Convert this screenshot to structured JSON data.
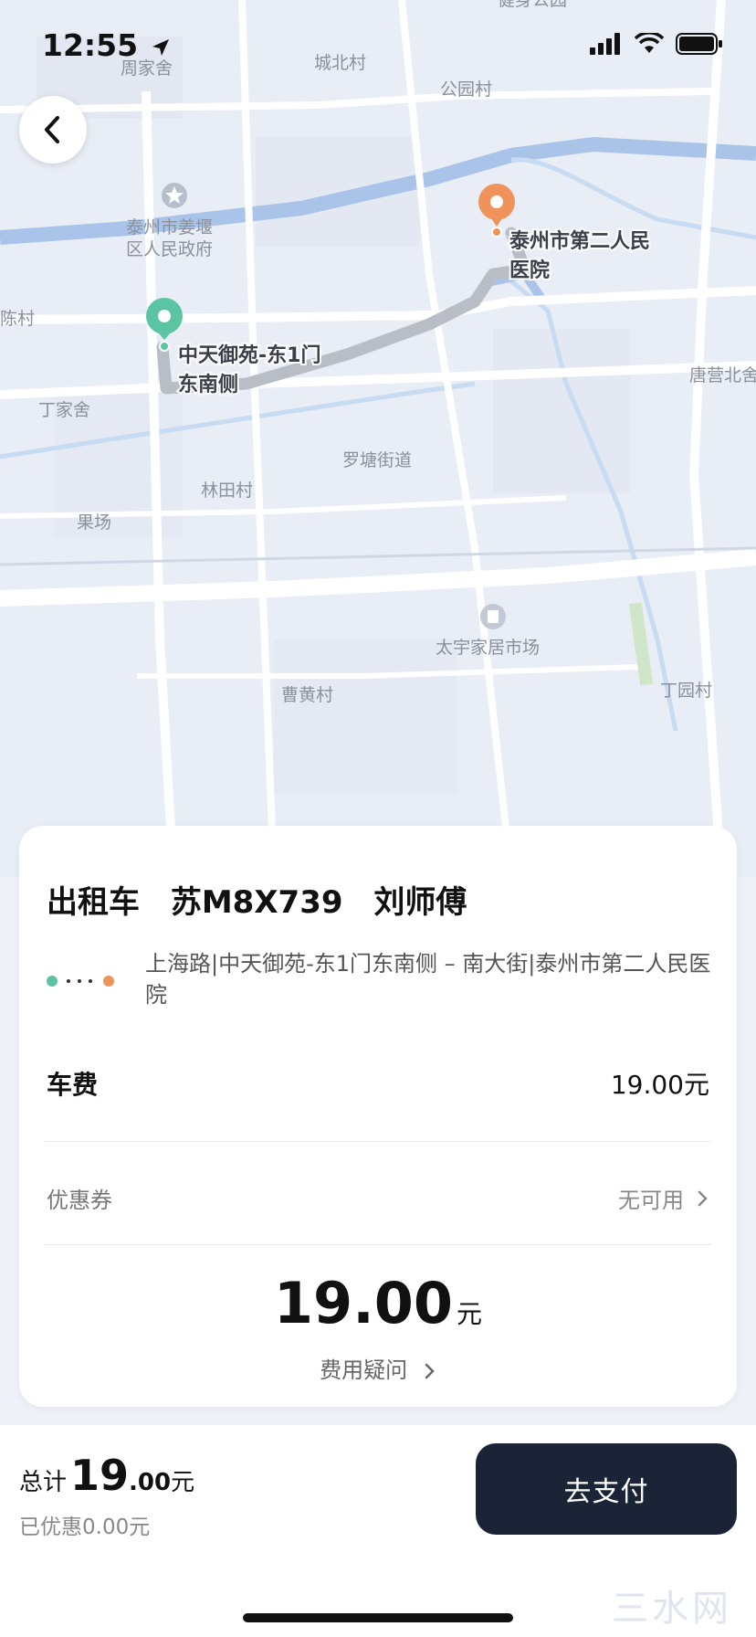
{
  "status_bar": {
    "time": "12:55"
  },
  "map": {
    "labels": [
      {
        "id": "zhoujiashe",
        "text": "周家舍"
      },
      {
        "id": "chengbeicun",
        "text": "城北村"
      },
      {
        "id": "gongyuancun",
        "text": "公园村"
      },
      {
        "id": "jianshengongyuan",
        "text": "健身公园"
      },
      {
        "id": "zhengfu1",
        "text": "泰州市姜堰"
      },
      {
        "id": "zhengfu2",
        "text": "区人民政府"
      },
      {
        "id": "chencun",
        "text": "陈村"
      },
      {
        "id": "dingjiashe",
        "text": "丁家舍"
      },
      {
        "id": "luotang",
        "text": "罗塘街道"
      },
      {
        "id": "lintiancun",
        "text": "林田村"
      },
      {
        "id": "guochang",
        "text": "果场"
      },
      {
        "id": "tangying",
        "text": "唐营北舍"
      },
      {
        "id": "taiyu",
        "text": "太宇家居市场"
      },
      {
        "id": "caohuang",
        "text": "曹黄村"
      },
      {
        "id": "dingyuan",
        "text": "丁园村"
      }
    ],
    "origin_label_line1": "中天御苑-东1门",
    "origin_label_line2": "东南侧",
    "dest_label_line1": "泰州市第二人民",
    "dest_label_line2": "医院",
    "colors": {
      "origin": "#5bc4a2",
      "destination": "#f0935a",
      "route": "#b9bdc6"
    }
  },
  "order": {
    "vehicle_type": "出租车",
    "plate": "苏M8X739",
    "driver": "刘师傅",
    "route_text": "上海路|中天御苑-东1门东南侧 – 南大街|泰州市第二人民医院",
    "fare_label": "车费",
    "fare_value": "19.00元",
    "coupon_label": "优惠券",
    "coupon_value": "无可用",
    "total_amount": "19.00",
    "total_unit": "元",
    "fee_question": "费用疑问"
  },
  "footer": {
    "total_label": "总计",
    "total_int": "19",
    "total_dec": ".00",
    "total_unit": "元",
    "discount_text": "已优惠0.00元",
    "pay_button": "去支付",
    "watermark": "三水网"
  }
}
